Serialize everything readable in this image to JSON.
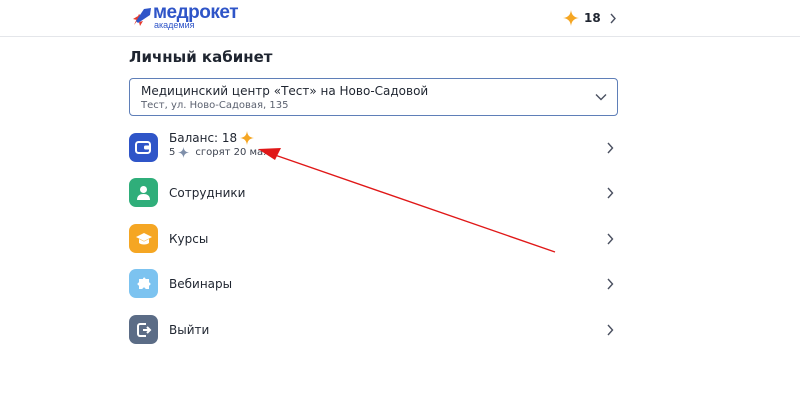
{
  "header": {
    "logo": {
      "name": "медрокет",
      "subtitle": "академия",
      "icon": "rocket-logo"
    },
    "balance": {
      "value": "18",
      "icon": "sparkle-icon",
      "chevron": "chevron-right-icon"
    }
  },
  "page": {
    "title": "Личный кабинет"
  },
  "organization_select": {
    "name": "Медицинский центр «Тест» на Ново-Садовой",
    "address": "Тест, ул. Ново-Садовая, 135",
    "icon": "chevron-down-icon"
  },
  "menu": {
    "balance": {
      "label": "Баланс: 18",
      "expiring_amount": "5",
      "expiring_text": "сгорят 20 мая",
      "icon": "wallet-icon",
      "color": "#2f55c8"
    },
    "employees": {
      "label": "Сотрудники",
      "icon": "user-icon",
      "color": "#2fae7a"
    },
    "courses": {
      "label": "Курсы",
      "icon": "graduation-cap-icon",
      "color": "#f5a623"
    },
    "webinars": {
      "label": "Вебинары",
      "icon": "puzzle-icon",
      "color": "#7cc3f0"
    },
    "logout": {
      "label": "Выйти",
      "icon": "logout-icon",
      "color": "#5b6c86"
    }
  },
  "colors": {
    "brand": "#2f55c8",
    "sparkle": "#f5a623",
    "annotation": "#e01818"
  }
}
